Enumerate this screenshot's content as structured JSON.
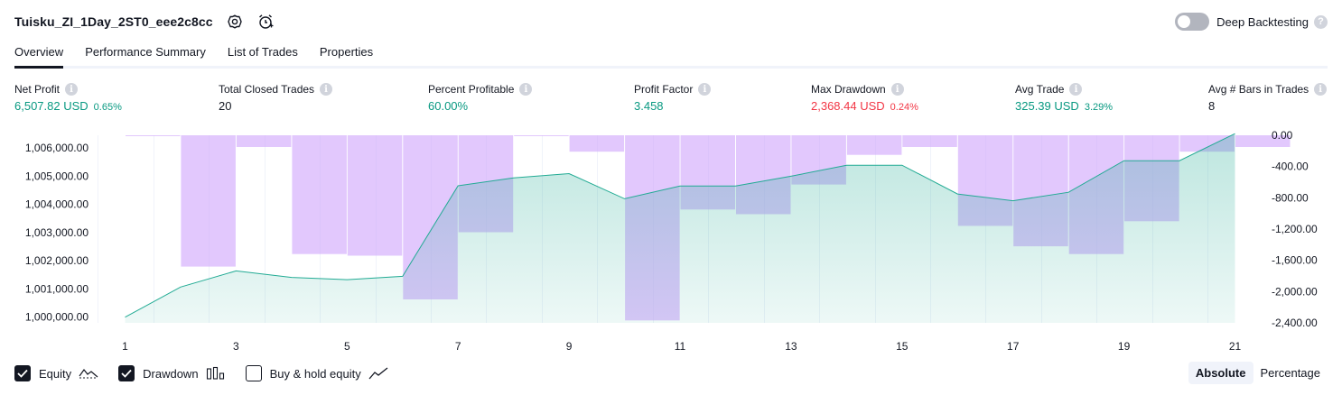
{
  "header": {
    "strategy_name": "Tuisku_ZI_1Day_2ST0_eee2c8cc",
    "settings_icon": "settings-gear-icon",
    "add_alert_icon": "alarm-clock-add-icon",
    "deep_backtesting_label": "Deep Backtesting",
    "deep_backtesting_enabled": false,
    "help_glyph": "?"
  },
  "tabs": [
    {
      "label": "Overview",
      "active": true
    },
    {
      "label": "Performance Summary",
      "active": false
    },
    {
      "label": "List of Trades",
      "active": false
    },
    {
      "label": "Properties",
      "active": false
    }
  ],
  "metrics": [
    {
      "label": "Net Profit",
      "value": "6,507.82 USD",
      "pct": "0.65%",
      "tone": "pos"
    },
    {
      "label": "Total Closed Trades",
      "value": "20",
      "pct": "",
      "tone": "neu"
    },
    {
      "label": "Percent Profitable",
      "value": "60.00%",
      "pct": "",
      "tone": "pos"
    },
    {
      "label": "Profit Factor",
      "value": "3.458",
      "pct": "",
      "tone": "pos"
    },
    {
      "label": "Max Drawdown",
      "value": "2,368.44 USD",
      "pct": "0.24%",
      "tone": "neg"
    },
    {
      "label": "Avg Trade",
      "value": "325.39 USD",
      "pct": "3.29%",
      "tone": "pos"
    },
    {
      "label": "Avg # Bars in Trades",
      "value": "8",
      "pct": "",
      "tone": "neu"
    }
  ],
  "info_glyph": "i",
  "colors": {
    "positive": "#089981",
    "negative": "#f23645",
    "equity_line": "#22ab94",
    "drawdown_bar": "#d1a6fb"
  },
  "chart_data": {
    "type": "area",
    "x_ticks": [
      "1",
      "3",
      "5",
      "7",
      "9",
      "11",
      "13",
      "15",
      "17",
      "19",
      "21"
    ],
    "left_axis": {
      "ticks": [
        "1,000,000.00",
        "1,001,000.00",
        "1,002,000.00",
        "1,003,000.00",
        "1,004,000.00",
        "1,005,000.00",
        "1,006,000.00"
      ],
      "range": [
        999800,
        1006450
      ]
    },
    "right_axis": {
      "ticks": [
        "0.00",
        "-400.00",
        "-800.00",
        "-1,200.00",
        "-1,600.00",
        "-2,000.00",
        "-2,400.00"
      ],
      "range": [
        -2400,
        0
      ]
    },
    "series": [
      {
        "type": "line",
        "x": [
          1,
          2,
          3,
          4,
          5,
          6,
          7,
          8,
          9,
          10,
          11,
          12,
          13,
          14,
          15,
          16,
          17,
          18,
          19,
          20,
          21
        ],
        "values": [
          1000000,
          1001070,
          1001640,
          1001410,
          1001330,
          1001450,
          1004660,
          1004940,
          1005090,
          1004200,
          1004650,
          1004650,
          1005000,
          1005390,
          1005390,
          1004370,
          1004130,
          1004430,
          1005550,
          1005550,
          1006507.82
        ]
      },
      {
        "type": "bar",
        "x": [
          1,
          2,
          3,
          4,
          5,
          6,
          7,
          8,
          9,
          10,
          11,
          12,
          13,
          14,
          15,
          16,
          17,
          18,
          19,
          20,
          21
        ],
        "values": [
          -10,
          -1680,
          -150,
          -1520,
          -1540,
          -2100,
          -1240,
          0,
          -210,
          -2368.44,
          -950,
          -1010,
          -630,
          -250,
          -150,
          -1160,
          -1420,
          -1520,
          -1100,
          -210,
          -150
        ]
      }
    ],
    "grid": "vertical"
  },
  "footer": {
    "checks": [
      {
        "label": "Equity",
        "checked": true,
        "icon": "equity-line-icon"
      },
      {
        "label": "Drawdown",
        "checked": true,
        "icon": "drawdown-bars-icon"
      },
      {
        "label": "Buy & hold equity",
        "checked": false,
        "icon": "buy-hold-line-icon"
      }
    ],
    "scale_buttons": [
      {
        "label": "Absolute",
        "active": true
      },
      {
        "label": "Percentage",
        "active": false
      }
    ]
  }
}
